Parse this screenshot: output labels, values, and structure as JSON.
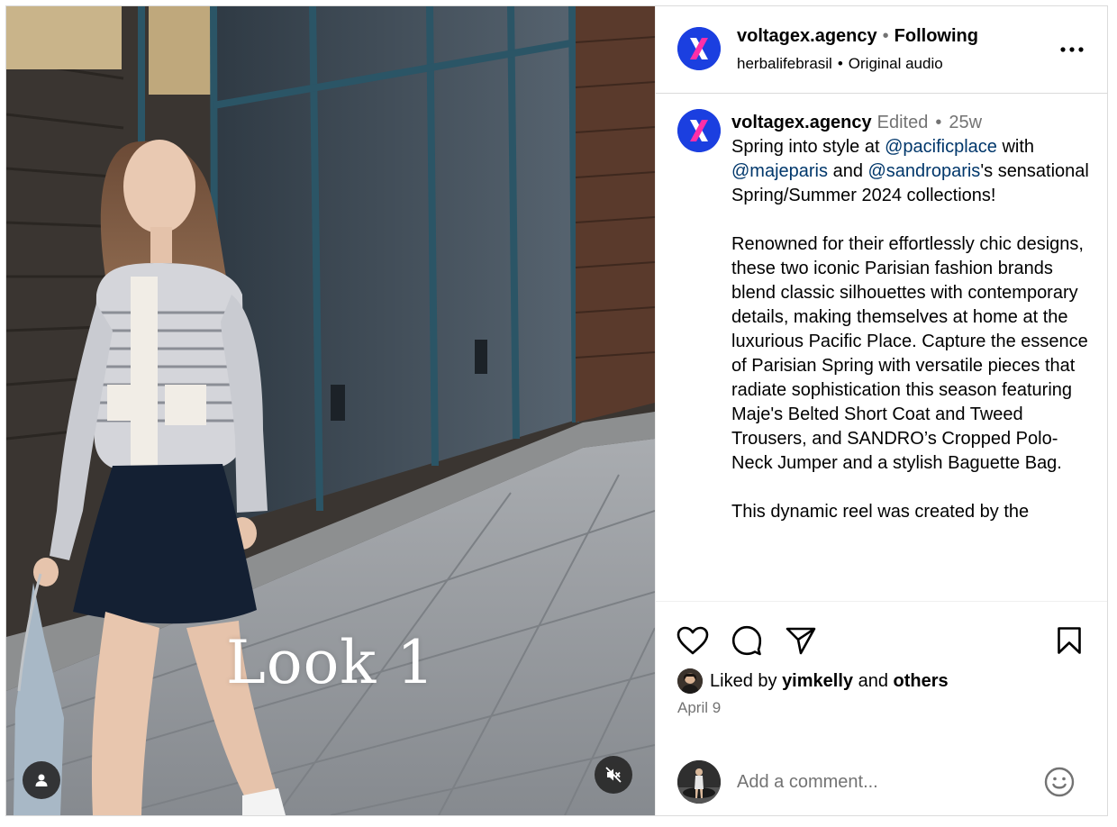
{
  "media": {
    "overlay_caption": "Look 1",
    "icons": {
      "user_tag": "user-silhouette-icon",
      "mute": "speaker-muted-icon"
    }
  },
  "header": {
    "username": "voltagex.agency",
    "separator": "•",
    "follow_status": "Following",
    "audio_account": "herbalifebrasil",
    "audio_label": "Original audio",
    "more_icon": "ellipsis-icon"
  },
  "caption": {
    "username": "voltagex.agency",
    "edited_label": "Edited",
    "age": "25w",
    "line1_pre": "Spring into style at ",
    "mention1": "@pacificplace",
    "line1_mid": " with ",
    "mention2": "@majeparis",
    "line1_and": " and ",
    "mention3": "@sandroparis",
    "line1_post": "'s sensational Spring/Summer 2024 collections!",
    "paragraph2": "Renowned for their effortlessly chic designs, these two iconic Parisian fashion brands blend classic silhouettes with contemporary details, making themselves at home at the luxurious Pacific Place. Capture the essence of Parisian Spring with versatile pieces that radiate sophistication this season featuring Maje's Belted Short Coat and Tweed Trousers, and SANDRO’s Cropped Polo-Neck Jumper and a stylish Baguette Bag.",
    "paragraph3": "This dynamic reel was created by the"
  },
  "actions": {
    "icons": [
      "heart-icon",
      "comment-icon",
      "share-icon",
      "bookmark-icon"
    ],
    "liked_prefix": "Liked by",
    "liked_user": "yimkelly",
    "liked_and": "and",
    "liked_others": "others",
    "date": "April 9"
  },
  "comment": {
    "placeholder": "Add a comment...",
    "emoji_icon": "smiley-icon"
  },
  "colors": {
    "link": "#00376b",
    "muted": "#737373",
    "brand_avatar_bg": "#1b3fe0",
    "brand_x_pink": "#ff2fa8"
  }
}
